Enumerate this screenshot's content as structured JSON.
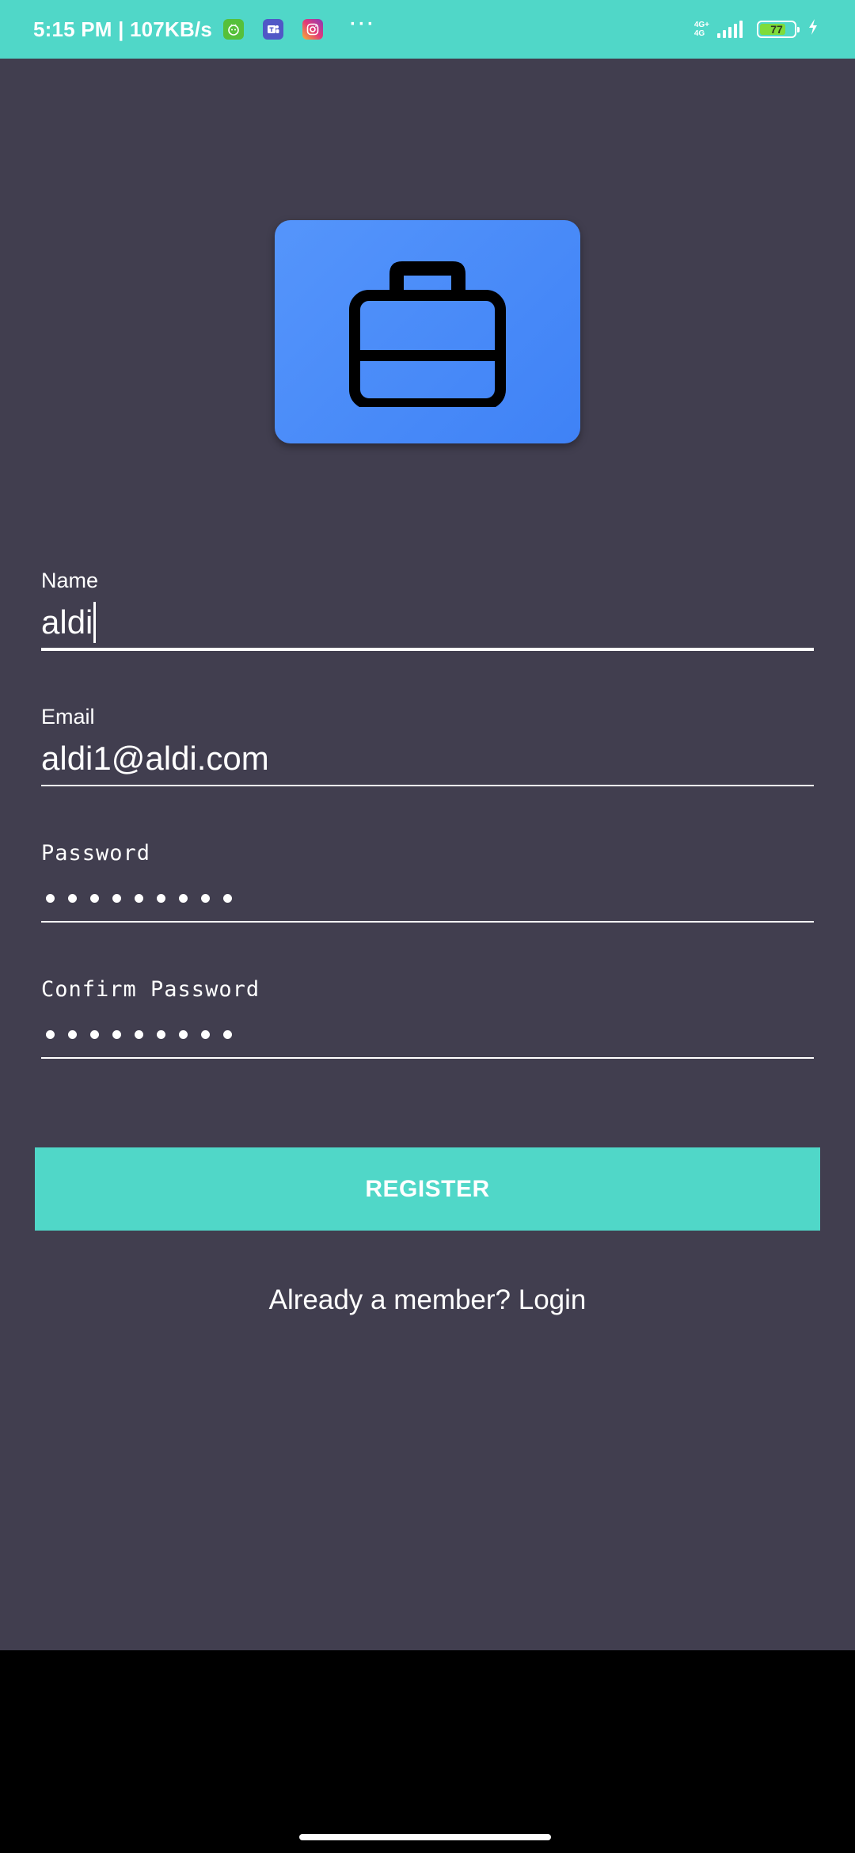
{
  "status_bar": {
    "time_speed": "5:15 PM | 107KB/s",
    "more_indicator": "···",
    "network_top": "4G+",
    "network_bottom": "4G",
    "battery_level": "77",
    "battery_fraction": 0.77,
    "notification_icons": [
      "green-app-icon",
      "teams-icon",
      "instagram-icon"
    ],
    "charging_icon": "bolt-icon",
    "colors": {
      "status_bar": "#50d7c8",
      "battery_fill": "#7fdc3a"
    }
  },
  "app": {
    "logo_icon": "briefcase-icon",
    "colors": {
      "background": "#413e4f",
      "logo_card": "#4a8cf8",
      "accent": "#50d7c8"
    }
  },
  "form": {
    "name": {
      "label": "Name",
      "value": "aldi"
    },
    "email": {
      "label": "Email",
      "value": "aldi1@aldi.com"
    },
    "password": {
      "label": "Password",
      "masked_length": 9
    },
    "confirm_password": {
      "label": "Confirm Password",
      "masked_length": 9
    },
    "register_label": "REGISTER",
    "login_prompt": "Already a member? Login"
  }
}
